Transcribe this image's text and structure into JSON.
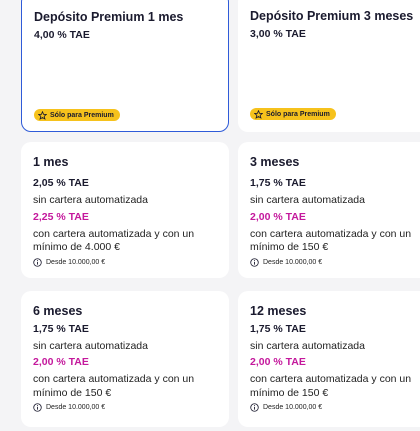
{
  "premium_cards": [
    {
      "title": "Depósito Premium 1 mes",
      "rate": "4,00 % TAE",
      "badge": "Sólo para Premium"
    },
    {
      "title": "Depósito Premium 3 meses",
      "rate": "3,00 % TAE",
      "badge": "Sólo para Premium"
    }
  ],
  "term_cards": [
    {
      "title": "1 mes",
      "rate": "2,05 % TAE",
      "rate_desc": "sin cartera automatizada",
      "boost_rate": "2,25 % TAE",
      "boost_desc_1": "con cartera automatizada y con un",
      "boost_desc_2": "mínimo de 4.000 €",
      "min": "Desde 10.000,00 €"
    },
    {
      "title": "3 meses",
      "rate": "1,75 % TAE",
      "rate_desc": "sin cartera automatizada",
      "boost_rate": "2,00 % TAE",
      "boost_desc_1": "con cartera automatizada y con un",
      "boost_desc_2": "mínimo de 150 €",
      "min": "Desde 10.000,00 €"
    },
    {
      "title": "6 meses",
      "rate": "1,75 % TAE",
      "rate_desc": "sin cartera automatizada",
      "boost_rate": "2,00 % TAE",
      "boost_desc_1": "con cartera automatizada y con un",
      "boost_desc_2": "mínimo de 150 €",
      "min": "Desde 10.000,00 €"
    },
    {
      "title": "12 meses",
      "rate": "1,75 % TAE",
      "rate_desc": "sin cartera automatizada",
      "boost_rate": "2,00 % TAE",
      "boost_desc_1": "con cartera automatizada y con un",
      "boost_desc_2": "mínimo de 150 €",
      "min": "Desde 10.000,00 €"
    }
  ],
  "colors": {
    "accent_border": "#2f5bd8",
    "badge_bg": "#f6c21c",
    "boost_text": "#c4189c"
  },
  "icons": {
    "badge": "star-icon",
    "min_amount": "info-icon"
  }
}
